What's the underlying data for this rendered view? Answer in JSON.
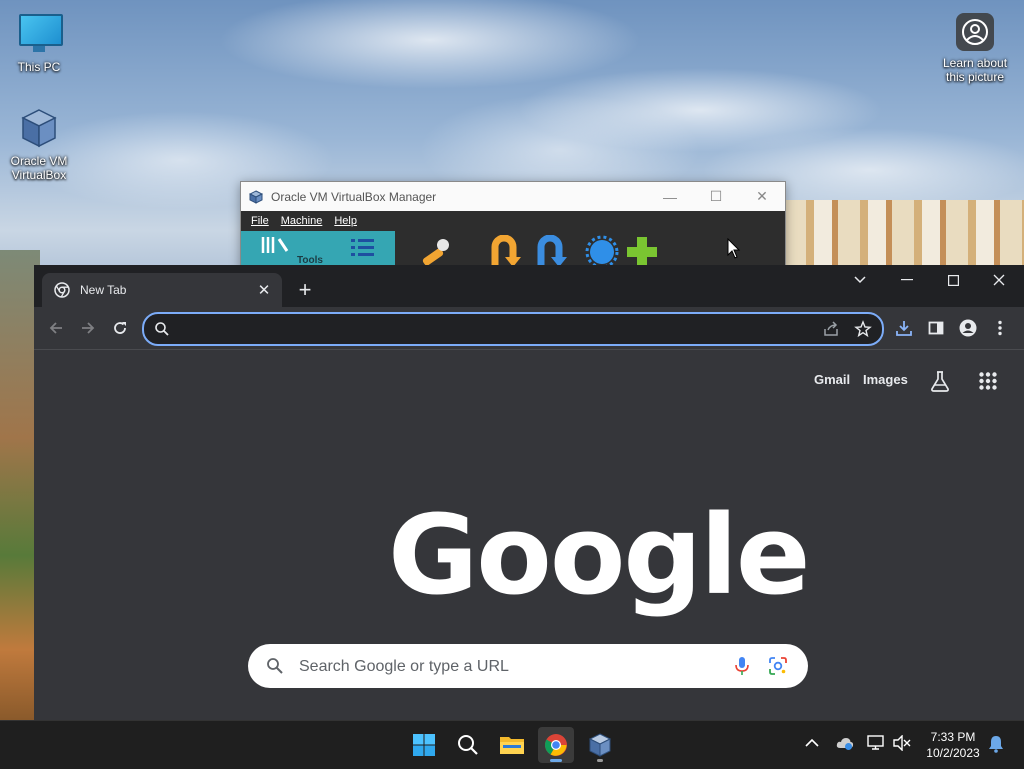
{
  "desktop": {
    "icons": [
      {
        "label": "This PC"
      },
      {
        "label": "Oracle VM VirtualBox"
      }
    ],
    "spotlight": {
      "label": "Learn about this picture"
    }
  },
  "virtualbox": {
    "title": "Oracle VM VirtualBox Manager",
    "menu": [
      "File",
      "Machine",
      "Help"
    ],
    "tools_label": "Tools"
  },
  "chrome": {
    "tab": {
      "title": "New Tab"
    },
    "omnibox": {
      "value": "",
      "placeholder": ""
    },
    "ntp": {
      "links": [
        "Gmail",
        "Images"
      ],
      "logo": "Google",
      "search_placeholder": "Search Google or type a URL"
    },
    "colors": {
      "accent": "#7cacf8",
      "background": "#35363a",
      "tabbar": "#202124"
    }
  },
  "taskbar": {
    "apps": [
      "start-icon",
      "search-icon",
      "file-explorer-icon",
      "chrome-icon",
      "virtualbox-icon"
    ],
    "active": "chrome-icon",
    "clock": {
      "time": "7:33 PM",
      "date": "10/2/2023"
    }
  }
}
